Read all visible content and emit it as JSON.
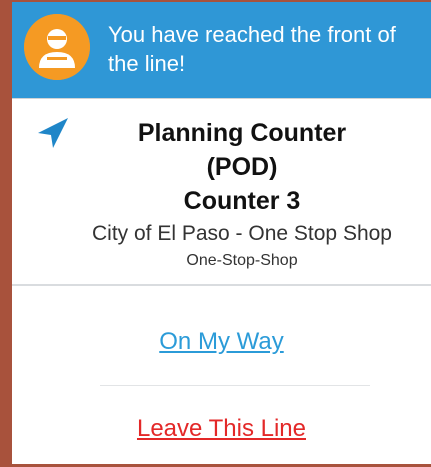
{
  "banner": {
    "message": "You have reached the front of the line!",
    "avatar_icon": "person-avatar-icon"
  },
  "service": {
    "nav_icon": "navigation-arrow-icon",
    "name_line1": "Planning Counter",
    "name_line2": "(POD)",
    "counter": "Counter 3",
    "location": "City of El Paso - One Stop Shop",
    "category": "One-Stop-Shop"
  },
  "actions": {
    "on_my_way": "On My Way",
    "leave_line": "Leave This Line"
  },
  "colors": {
    "banner": "#2f97d6",
    "avatar": "#f59a23",
    "link_primary": "#2b9bd8",
    "link_danger": "#e32828",
    "frame_border": "#a8523c"
  }
}
